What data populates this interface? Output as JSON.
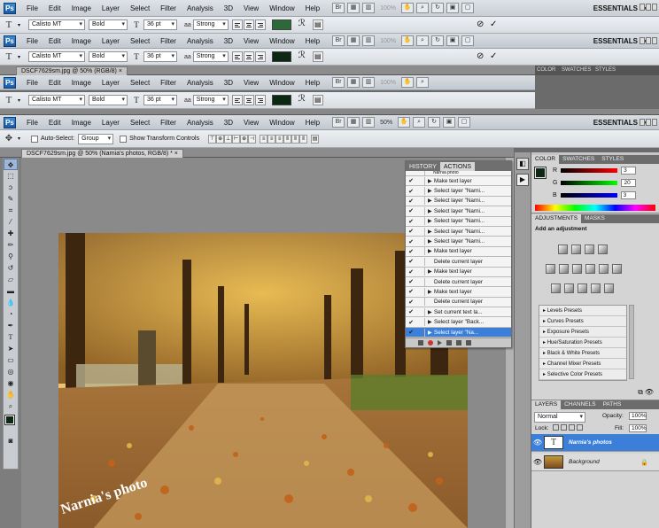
{
  "menu": {
    "logo": "Ps",
    "items": [
      "File",
      "Edit",
      "Image",
      "Layer",
      "Select",
      "Filter",
      "Analysis",
      "3D",
      "View",
      "Window",
      "Help"
    ],
    "zoom_dim": "100%",
    "zoom": "50%",
    "workspace": "ESSENTIALS"
  },
  "type_options": {
    "tool_glyph": "T",
    "font_family": "Calisto MT",
    "font_style": "Bold",
    "size_glyph": "T",
    "font_size": "36 pt",
    "aa_glyph": "aa",
    "antialias": "Strong",
    "swatch_green": "#2b6a38",
    "swatch_dark": "#0d2812",
    "cancel": "⊘",
    "commit": "✓"
  },
  "doc_tabs": {
    "old": "DSCF7629sm.jpg @ 50% (RGB/8)",
    "current": "DSCF7629sm.jpg @ 50% (Narnia's photos, RGB/8) *",
    "close": "×"
  },
  "move_options": {
    "auto_select_label": "Auto-Select:",
    "auto_select_value": "Group",
    "transform_label": "Show Transform Controls"
  },
  "actions_panel": {
    "tabs": [
      "HISTORY",
      "ACTIONS"
    ],
    "top_partial": "Narnia photo",
    "rows": [
      {
        "label": "Make text layer",
        "selected": false
      },
      {
        "label": "Select layer \"Narni...",
        "selected": false
      },
      {
        "label": "Select layer \"Narni...",
        "selected": false
      },
      {
        "label": "Select layer \"Narni...",
        "selected": false
      },
      {
        "label": "Select layer \"Narni...",
        "selected": false
      },
      {
        "label": "Select layer \"Narni...",
        "selected": false
      },
      {
        "label": "Select layer \"Narni...",
        "selected": false
      },
      {
        "label": "Make text layer",
        "selected": false
      },
      {
        "label": "Delete current layer",
        "selected": false
      },
      {
        "label": "Make text layer",
        "selected": false
      },
      {
        "label": "Delete current layer",
        "selected": false
      },
      {
        "label": "Make text layer",
        "selected": false
      },
      {
        "label": "Delete current layer",
        "selected": false
      },
      {
        "label": "Set current text la...",
        "selected": false
      },
      {
        "label": "Select layer \"Back...",
        "selected": false
      },
      {
        "label": "Select layer \"Na...",
        "selected": true
      }
    ]
  },
  "color_panel": {
    "tabs": [
      "COLOR",
      "SWATCHES",
      "STYLES"
    ],
    "r_label": "R",
    "g_label": "G",
    "b_label": "B",
    "r": "3",
    "g": "20",
    "b": "3"
  },
  "adjustments_panel": {
    "tabs": [
      "ADJUSTMENTS",
      "MASKS"
    ],
    "heading": "Add an adjustment",
    "presets": [
      "Levels Presets",
      "Curves Presets",
      "Exposure Presets",
      "Hue/Saturation Presets",
      "Black & White Presets",
      "Channel Mixer Presets",
      "Selective Color Presets"
    ]
  },
  "layers_panel": {
    "tabs": [
      "LAYERS",
      "CHANNELS",
      "PATHS"
    ],
    "blend_mode": "Normal",
    "opacity_label": "Opacity:",
    "opacity": "100%",
    "lock_label": "Lock:",
    "fill_label": "Fill:",
    "fill": "100%",
    "layers": [
      {
        "name": "Narnia's photos",
        "selected": true
      },
      {
        "name": "Background",
        "selected": false
      }
    ]
  },
  "watermark_text": "Narnia's photo"
}
